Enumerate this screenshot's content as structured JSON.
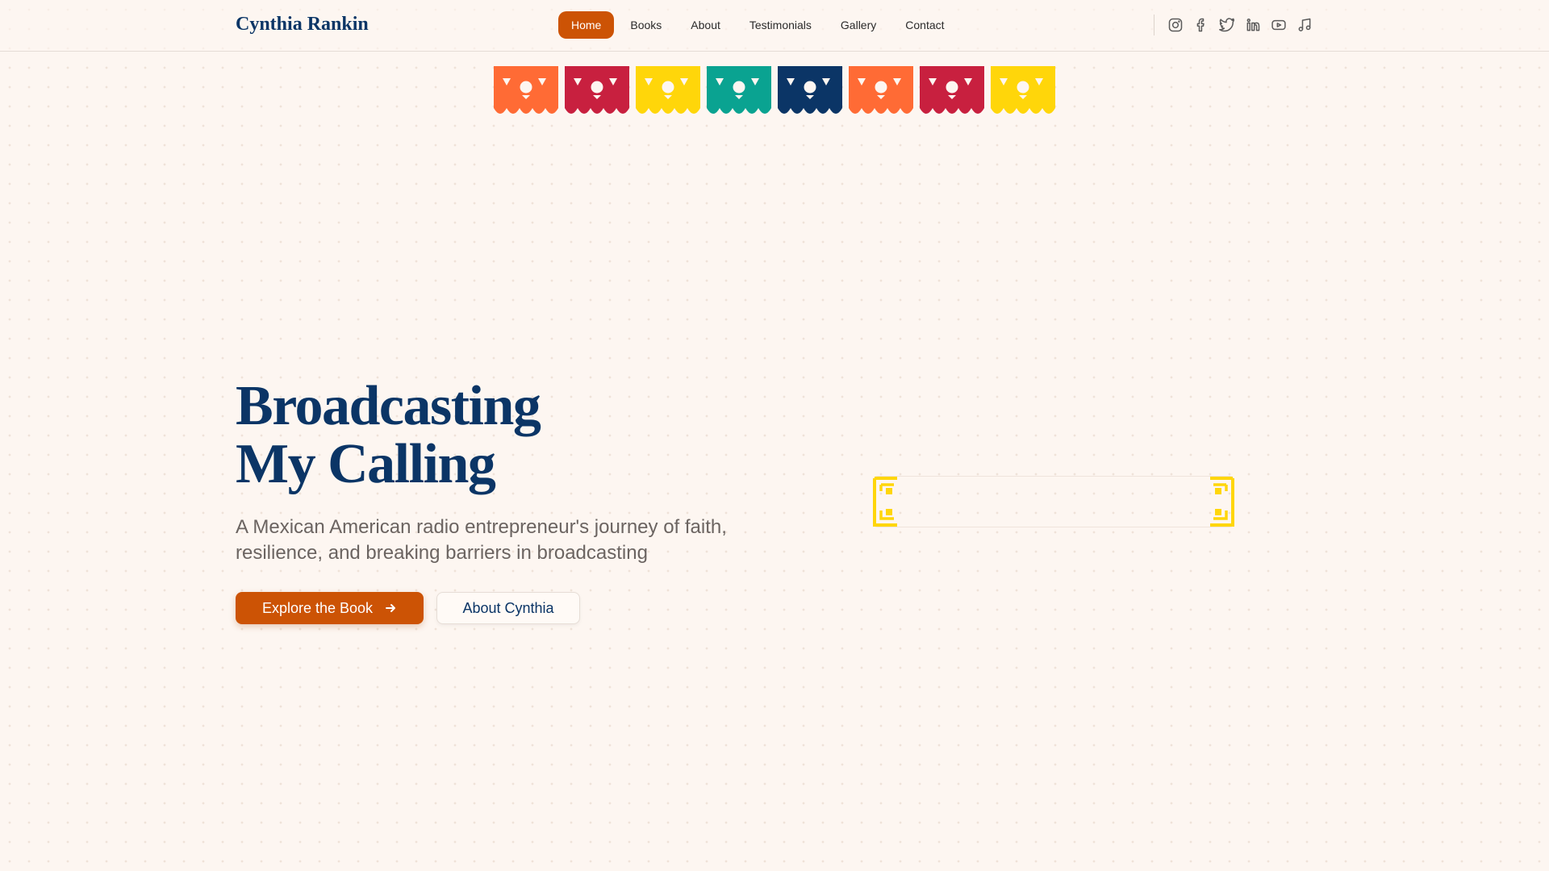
{
  "header": {
    "brand": "Cynthia Rankin",
    "nav": [
      {
        "label": "Home",
        "active": true
      },
      {
        "label": "Books",
        "active": false
      },
      {
        "label": "About",
        "active": false
      },
      {
        "label": "Testimonials",
        "active": false
      },
      {
        "label": "Gallery",
        "active": false
      },
      {
        "label": "Contact",
        "active": false
      }
    ],
    "social_icons": [
      "instagram-icon",
      "facebook-icon",
      "twitter-icon",
      "linkedin-icon",
      "youtube-icon",
      "music-note-icon"
    ]
  },
  "banner": {
    "flag_colors": [
      "#ff6b35",
      "#c8203f",
      "#ffd60a",
      "#0aa391",
      "#0b3566",
      "#ff6b35",
      "#c8203f",
      "#ffd60a"
    ]
  },
  "hero": {
    "title_line1": "Broadcasting",
    "title_line2": "My Calling",
    "subtitle": "A Mexican American radio entrepreneur's journey of faith, resilience, and breaking barriers in broadcasting",
    "primary_button": "Explore the Book",
    "primary_button_icon": "arrow-right-icon",
    "secondary_button": "About Cynthia"
  },
  "colors": {
    "brand_blue": "#0b3566",
    "accent_orange": "#cc5305",
    "frame_gold": "#ffd60a",
    "background": "#fdf6f1"
  }
}
